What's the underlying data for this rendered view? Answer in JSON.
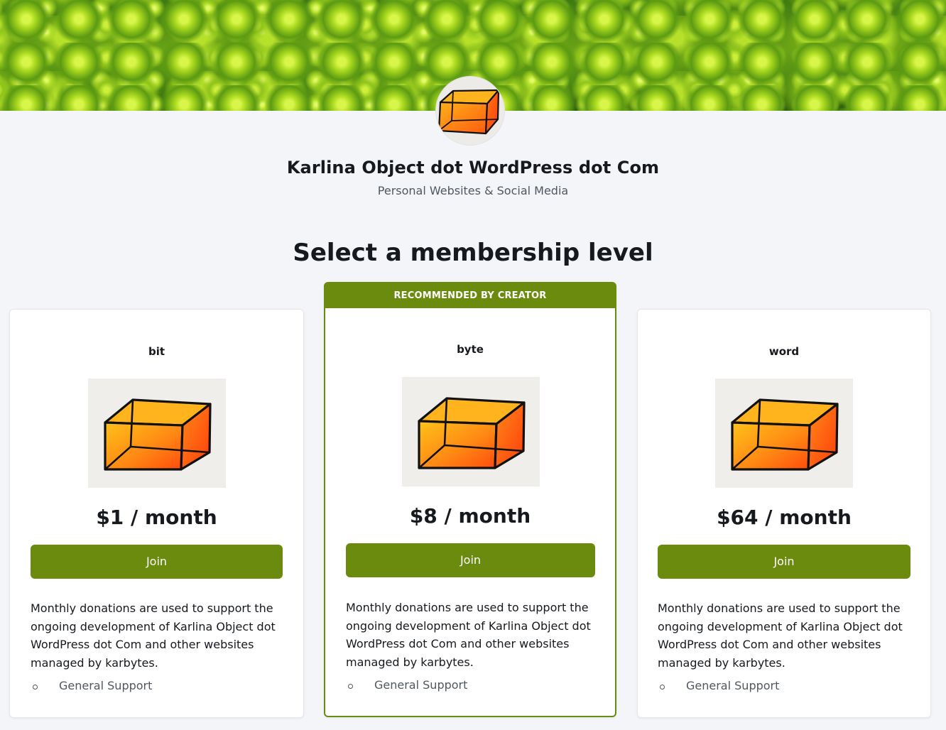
{
  "header": {
    "site_title": "Karlina Object dot WordPress dot Com",
    "site_subtitle": "Personal Websites & Social Media",
    "banner_icon": "romanesco-broccoli-banner",
    "avatar_icon": "orange-box-logo"
  },
  "main": {
    "heading": "Select a membership level",
    "tiers": [
      {
        "name": "bit",
        "price": "$1 / month",
        "join_label": "Join",
        "description": "Monthly donations are used to support the ongoing development of Karlina Object dot WordPress dot Com and other websites managed by karbytes.",
        "benefits": [
          "General Support"
        ]
      },
      {
        "name": "byte",
        "badge": "RECOMMENDED BY CREATOR",
        "price": "$8 / month",
        "join_label": "Join",
        "description": "Monthly donations are used to support the ongoing development of Karlina Object dot WordPress dot Com and other websites managed by karbytes.",
        "benefits": [
          "General Support"
        ]
      },
      {
        "name": "word",
        "price": "$64 / month",
        "join_label": "Join",
        "description": "Monthly donations are used to support the ongoing development of Karlina Object dot WordPress dot Com and other websites managed by karbytes.",
        "benefits": [
          "General Support"
        ]
      }
    ]
  },
  "colors": {
    "accent": "#6b8b0f",
    "page_background": "#f4f5f9",
    "card_background": "#ffffff",
    "text": "#16191d",
    "muted_text": "#50575e"
  }
}
